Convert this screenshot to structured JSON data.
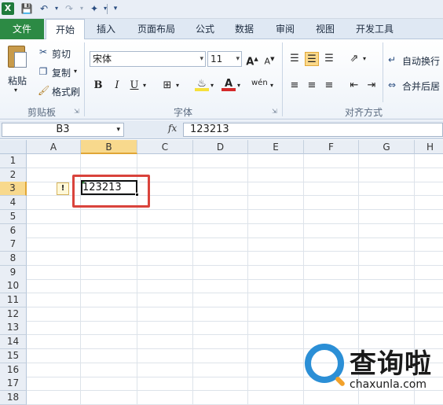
{
  "quick_access": {
    "excel_logo": "X",
    "save_icon": "save-icon",
    "undo_icon": "undo-icon",
    "redo_icon": "redo-icon",
    "customize_icon": "customize-icon"
  },
  "ribbon_tabs": [
    "文件",
    "开始",
    "插入",
    "页面布局",
    "公式",
    "数据",
    "审阅",
    "视图",
    "开发工具"
  ],
  "clipboard": {
    "paste": "粘贴",
    "cut": "剪切",
    "copy": "复制",
    "format_painter": "格式刷",
    "group": "剪贴板"
  },
  "font": {
    "name": "宋体",
    "size": "11",
    "bold": "B",
    "italic": "I",
    "underline": "U",
    "grow": "A",
    "shrink": "A",
    "color_letter": "A",
    "wen_letter": "wén",
    "group": "字体"
  },
  "alignment": {
    "wrap_text": "自动换行",
    "merge_center": "合并后居",
    "group": "对齐方式"
  },
  "formula_bar": {
    "name_box": "B3",
    "fx": "fx",
    "content": "123213"
  },
  "columns": [
    "A",
    "B",
    "C",
    "D",
    "E",
    "F",
    "G",
    "H"
  ],
  "rows": [
    "1",
    "2",
    "3",
    "4",
    "5",
    "6",
    "7",
    "8",
    "9",
    "10",
    "11",
    "12",
    "13",
    "14",
    "15",
    "16",
    "17",
    "18"
  ],
  "selected_cell": {
    "column": "B",
    "row": "3",
    "value": "123213"
  },
  "watermark": {
    "text": "查询啦",
    "url": "chaxunla.com"
  },
  "colors": {
    "file_tab": "#2c8a44",
    "selection_header": "#f8d98d",
    "highlight_box": "#d9433c",
    "logo_blue": "#2b8fd6"
  }
}
